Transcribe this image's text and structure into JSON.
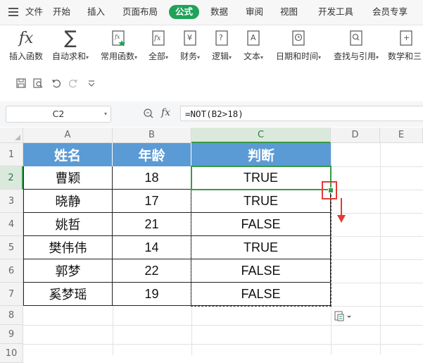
{
  "menu": {
    "file": "文件",
    "tabs": [
      "开始",
      "插入",
      "页面布局",
      "公式",
      "数据",
      "审阅",
      "视图",
      "开发工具",
      "会员专享"
    ],
    "active_tab": "公式"
  },
  "ribbon": [
    {
      "label": "插入函数",
      "icon": "fx-icon"
    },
    {
      "label": "自动求和",
      "icon": "sigma-icon",
      "dropdown": true
    },
    {
      "label": "常用函数",
      "icon": "star-fx-icon",
      "dropdown": true
    },
    {
      "label": "全部",
      "icon": "all-fx-icon",
      "dropdown": true
    },
    {
      "label": "财务",
      "icon": "yen-book-icon",
      "dropdown": true
    },
    {
      "label": "逻辑",
      "icon": "question-book-icon",
      "dropdown": true
    },
    {
      "label": "文本",
      "icon": "a-book-icon",
      "dropdown": true
    },
    {
      "label": "日期和时间",
      "icon": "clock-book-icon",
      "dropdown": true
    },
    {
      "label": "查找与引用",
      "icon": "search-book-icon",
      "dropdown": true
    },
    {
      "label": "数学和三",
      "icon": "plus-book-icon"
    }
  ],
  "formula_bar": {
    "name_box": "C2",
    "fx": "fx",
    "formula": "=NOT(B2>18)"
  },
  "columns": [
    "A",
    "B",
    "C",
    "D",
    "E"
  ],
  "rows": [
    "1",
    "2",
    "3",
    "4",
    "5",
    "6",
    "7",
    "8",
    "9",
    "10"
  ],
  "table": {
    "headers": [
      "姓名",
      "年龄",
      "判断"
    ],
    "rows": [
      [
        "曹颖",
        "18",
        "TRUE"
      ],
      [
        "晓静",
        "17",
        "TRUE"
      ],
      [
        "姚哲",
        "21",
        "FALSE"
      ],
      [
        "樊伟伟",
        "14",
        "TRUE"
      ],
      [
        "郭梦",
        "22",
        "FALSE"
      ],
      [
        "奚梦瑶",
        "19",
        "FALSE"
      ]
    ]
  },
  "selection": {
    "active_cell": "C2",
    "selected_column": "C",
    "selected_row": "2"
  },
  "colors": {
    "accent_green": "#1fa25a",
    "header_fill": "#5b9bd5",
    "highlight_red": "#e53935"
  }
}
